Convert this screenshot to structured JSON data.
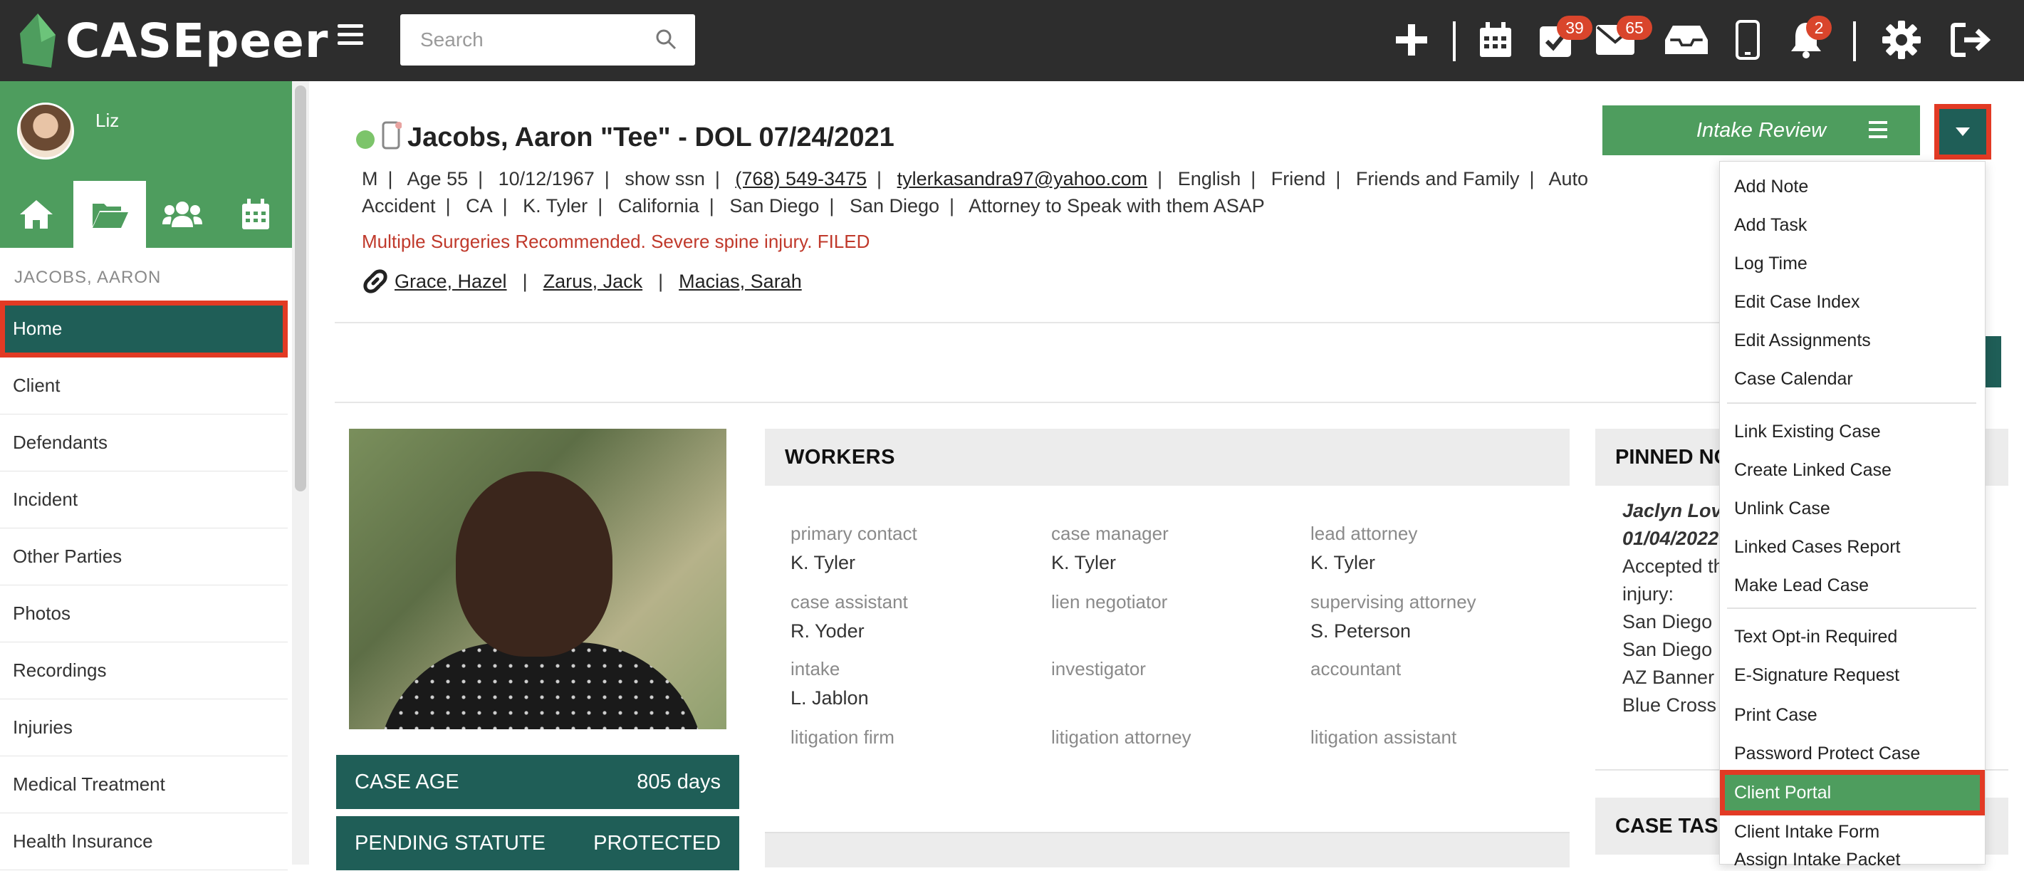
{
  "app": {
    "logo_text": "CASEpeer"
  },
  "topbar": {
    "search_placeholder": "Search",
    "badges": {
      "tasks": "39",
      "mail": "65",
      "notifications": "2"
    }
  },
  "sidebar": {
    "username": "Liz",
    "case_label": "JACOBS, AARON",
    "items": [
      {
        "label": "Home"
      },
      {
        "label": "Client"
      },
      {
        "label": "Defendants"
      },
      {
        "label": "Incident"
      },
      {
        "label": "Other Parties"
      },
      {
        "label": "Photos"
      },
      {
        "label": "Recordings"
      },
      {
        "label": "Injuries"
      },
      {
        "label": "Medical Treatment"
      },
      {
        "label": "Health Insurance"
      }
    ]
  },
  "case": {
    "title": "Jacobs, Aaron \"Tee\" - DOL 07/24/2021",
    "meta1": [
      "M",
      "Age 55",
      "10/12/1967",
      "show ssn",
      "(768) 549-3475",
      "tylerkasandra97@yahoo.com",
      "English",
      "Friend",
      "Friends and Family",
      "Auto"
    ],
    "meta2": [
      "Accident",
      "CA",
      "K. Tyler",
      "California",
      "San Diego",
      "San Diego",
      "Attorney to Speak with them ASAP"
    ],
    "alert": "Multiple Surgeries Recommended. Severe spine injury. FILED",
    "linked": [
      "Grace, Hazel",
      "Zarus, Jack",
      "Macias, Sarah"
    ]
  },
  "intake_review": {
    "label": "Intake Review"
  },
  "stats": [
    {
      "label": "CASE AGE",
      "value": "805 days"
    },
    {
      "label": "PENDING STATUTE",
      "value": "PROTECTED"
    }
  ],
  "workers": {
    "title": "WORKERS",
    "items": [
      {
        "label": "primary contact",
        "value": "K. Tyler"
      },
      {
        "label": "case manager",
        "value": "K. Tyler"
      },
      {
        "label": "lead attorney",
        "value": "K. Tyler"
      },
      {
        "label": "case assistant",
        "value": "R. Yoder"
      },
      {
        "label": "lien negotiator",
        "value": ""
      },
      {
        "label": "supervising attorney",
        "value": "S. Peterson"
      },
      {
        "label": "intake",
        "value": "L. Jablon"
      },
      {
        "label": "investigator",
        "value": ""
      },
      {
        "label": "accountant",
        "value": ""
      },
      {
        "label": "litigation firm",
        "value": ""
      },
      {
        "label": "litigation attorney",
        "value": ""
      },
      {
        "label": "litigation assistant",
        "value": ""
      }
    ]
  },
  "pinned": {
    "title": "PINNED NO",
    "author": "Jaclyn Lova",
    "date": "01/04/2022",
    "lines": [
      "Accepted th",
      "injury:",
      "San Diego I",
      "San Diego I",
      "AZ Banner",
      "Blue Cross"
    ]
  },
  "tasks": {
    "title": "CASE TAS"
  },
  "dropdown": {
    "items": [
      {
        "label": "Add Note"
      },
      {
        "label": "Add Task"
      },
      {
        "label": "Log Time"
      },
      {
        "label": "Edit Case Index"
      },
      {
        "label": "Edit Assignments"
      },
      {
        "label": "Case Calendar"
      },
      {
        "label": "Link Existing Case"
      },
      {
        "label": "Create Linked Case"
      },
      {
        "label": "Unlink Case"
      },
      {
        "label": "Linked Cases Report"
      },
      {
        "label": "Make Lead Case"
      },
      {
        "label": "Text Opt-in Required"
      },
      {
        "label": "E-Signature Request"
      },
      {
        "label": "Print Case"
      },
      {
        "label": "Password Protect Case"
      },
      {
        "label": "Client Portal"
      },
      {
        "label": "Client Intake Form"
      },
      {
        "label": "Assign Intake Packet"
      }
    ]
  },
  "colors": {
    "green": "#4e9d5e",
    "dark_teal": "#1f5e57",
    "highlight": "#e23a24",
    "topbar": "#2d2d2d",
    "alert": "#c0392b"
  }
}
